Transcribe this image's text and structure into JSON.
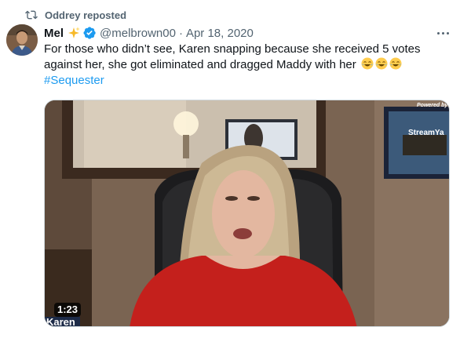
{
  "repost": {
    "text": "Oddrey reposted"
  },
  "author": {
    "name": "Mel",
    "handle": "@melbrown00",
    "separator": "·",
    "date": "Apr 18, 2020"
  },
  "tweet": {
    "text": "For those who didn’t see, Karen snapping because she received 5 votes against her, she got eliminated and dragged Maddy with her",
    "emojis": [
      "joy-emoji",
      "joy-emoji",
      "joy-emoji"
    ],
    "hashtag": "#Sequester"
  },
  "media": {
    "duration": "1:23",
    "lower_third_name": "Karen",
    "watermark_powered": "Powered by",
    "watermark_brand": "StreamYa"
  },
  "colors": {
    "link": "#1d9bf0",
    "secondary_text": "#536471",
    "verified": "#1d9bf0"
  }
}
